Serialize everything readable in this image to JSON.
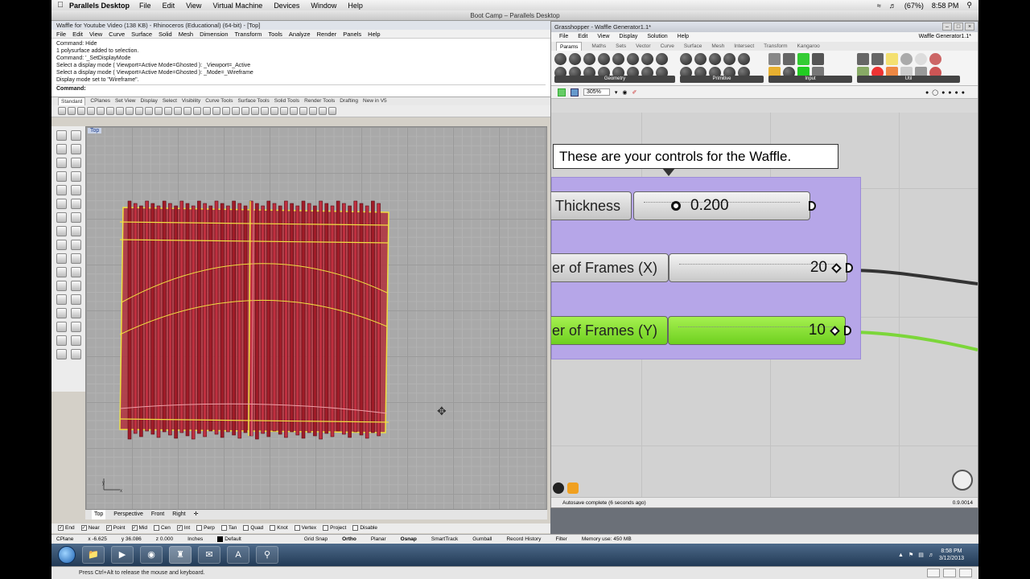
{
  "mac_menubar": {
    "app": "Parallels Desktop",
    "items": [
      "File",
      "Edit",
      "View",
      "Virtual Machine",
      "Devices",
      "Window",
      "Help"
    ],
    "battery": "(67%)",
    "time": "8:58 PM"
  },
  "pd_title": "Boot Camp – Parallels Desktop",
  "rhino": {
    "title": "Waffle for Youtube Video (138 KB) - Rhinoceros (Educational) (64-bit) - [Top]",
    "menu": [
      "File",
      "Edit",
      "View",
      "Curve",
      "Surface",
      "Solid",
      "Mesh",
      "Dimension",
      "Transform",
      "Tools",
      "Analyze",
      "Render",
      "Panels",
      "Help"
    ],
    "command_history": [
      "Command: Hide",
      "1 polysurface added to selection.",
      "Command: '_SetDisplayMode",
      "Select a display mode ( Viewport=Active  Mode=Ghosted ): _Viewport=_Active",
      "Select a display mode ( Viewport=Active  Mode=Ghosted ): _Mode=_Wireframe",
      "Display mode set to \"Wireframe\"."
    ],
    "command_prompt": "Command:",
    "toolbar_tabs": [
      "Standard",
      "CPlanes",
      "Set View",
      "Display",
      "Select",
      "Visibility",
      "Curve Tools",
      "Surface Tools",
      "Solid Tools",
      "Render Tools",
      "Drafting",
      "New in V5"
    ],
    "viewport_label": "Top",
    "viewport_tabs": [
      "Top",
      "Perspective",
      "Front",
      "Right"
    ],
    "osnaps": [
      {
        "label": "End",
        "checked": true
      },
      {
        "label": "Near",
        "checked": true
      },
      {
        "label": "Point",
        "checked": true
      },
      {
        "label": "Mid",
        "checked": true
      },
      {
        "label": "Cen",
        "checked": false
      },
      {
        "label": "Int",
        "checked": true
      },
      {
        "label": "Perp",
        "checked": false
      },
      {
        "label": "Tan",
        "checked": false
      },
      {
        "label": "Quad",
        "checked": false
      },
      {
        "label": "Knot",
        "checked": false
      },
      {
        "label": "Vertex",
        "checked": false
      },
      {
        "label": "Project",
        "checked": false
      },
      {
        "label": "Disable",
        "checked": false
      }
    ],
    "status": {
      "cplane": "CPlane",
      "x": "x -6.625",
      "y": "y 36.086",
      "z": "z 0.000",
      "units": "Inches",
      "layer": "Default",
      "toggles": [
        "Grid Snap",
        "Ortho",
        "Planar",
        "Osnap",
        "SmartTrack",
        "Gumball",
        "Record History",
        "Filter"
      ],
      "memory": "Memory use: 450 MB"
    }
  },
  "grasshopper": {
    "title": "Grasshopper - Waffle Generator1.1*",
    "menu": [
      "File",
      "Edit",
      "View",
      "Display",
      "Solution",
      "Help"
    ],
    "document": "Waffle Generator1.1*",
    "tabs": [
      "Params",
      "Maths",
      "Sets",
      "Vector",
      "Curve",
      "Surface",
      "Mesh",
      "Intersect",
      "Transform",
      "Kangaroo"
    ],
    "ribbon_groups": [
      "Geometry",
      "Primitive",
      "Input",
      "Util"
    ],
    "zoom": "305%",
    "bubble_text": "These are your controls for the Waffle.",
    "sliders": [
      {
        "label": "Thickness",
        "value": "0.200",
        "color": "grey"
      },
      {
        "label": "er of Frames (X)",
        "value": "20",
        "color": "grey"
      },
      {
        "label": "er of Frames (Y)",
        "value": "10",
        "color": "green"
      }
    ],
    "status": "Autosave complete (6 seconds ago)",
    "version": "0.9.0014"
  },
  "taskbar": {
    "time": "8:58 PM",
    "date": "3/12/2013"
  },
  "pd_bottom": "Press Ctrl+Alt to release the mouse and keyboard.",
  "colors": {
    "group": "#b6a6e8",
    "waffle_red": "#b02030",
    "waffle_yellow": "#f0e040",
    "slider_green": "#86e03a"
  }
}
